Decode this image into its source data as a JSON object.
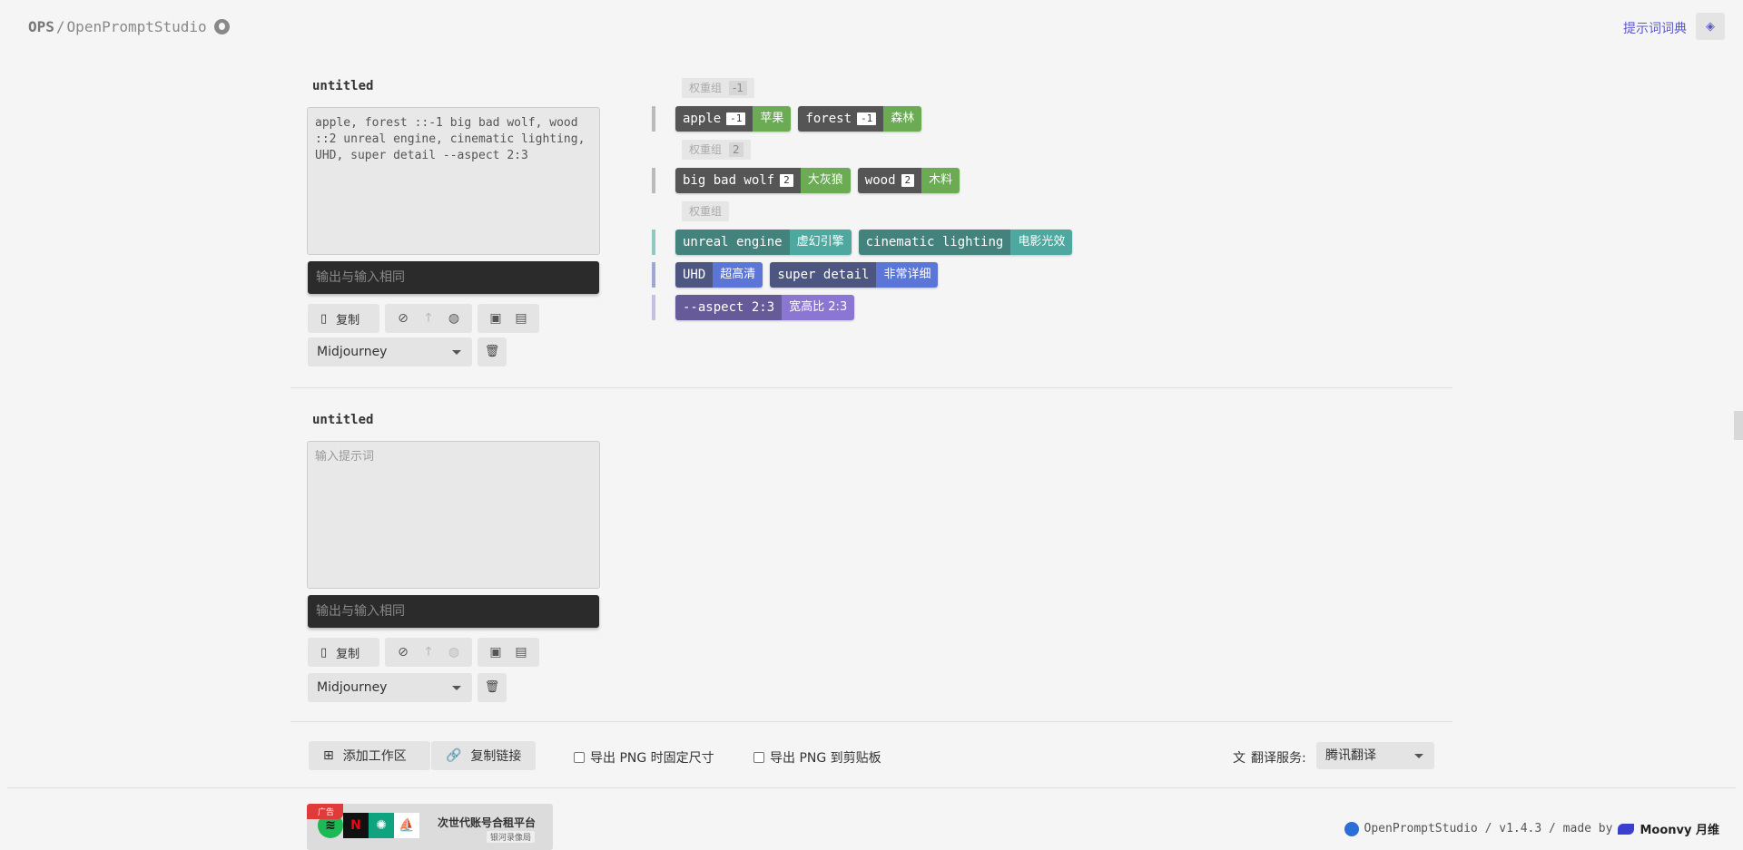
{
  "header": {
    "logo_ops": "OPS",
    "logo_sep": "/",
    "logo_name": "OpenPromptStudio",
    "dict_link": "提示词词典"
  },
  "workspaces": [
    {
      "title": "untitled",
      "prompt": "apple, forest ::-1 big bad wolf, wood ::2 unreal engine, cinematic lighting, UHD, super detail --aspect 2:3",
      "output": "输出与输入相同",
      "copy_label": "复制",
      "model": "Midjourney",
      "groups": [
        {
          "label": "权重组",
          "weight": "-1",
          "rows": [
            [
              {
                "en": "apple",
                "w": "-1",
                "cn": "苹果",
                "c1": "#555555",
                "c2": "#6aab54"
              },
              {
                "en": "forest",
                "w": "-1",
                "cn": "森林",
                "c1": "#555555",
                "c2": "#6aab54"
              }
            ]
          ]
        },
        {
          "label": "权重组",
          "weight": "2",
          "rows": [
            [
              {
                "en": "big bad wolf",
                "w": "2",
                "cn": "大灰狼",
                "c1": "#555555",
                "c2": "#6aab54"
              },
              {
                "en": "wood",
                "w": "2",
                "cn": "木料",
                "c1": "#555555",
                "c2": "#6aab54"
              }
            ]
          ]
        },
        {
          "label": "权重组",
          "weight": "",
          "rows": [
            [
              {
                "en": "unreal engine",
                "w": "",
                "cn": "虚幻引擎",
                "c1": "#44827e",
                "c2": "#4ea89f"
              },
              {
                "en": "cinematic lighting",
                "w": "",
                "cn": "电影光效",
                "c1": "#44827e",
                "c2": "#4ea89f"
              }
            ],
            [
              {
                "en": "UHD",
                "w": "",
                "cn": "超高清",
                "c1": "#4c5680",
                "c2": "#5b76d6"
              },
              {
                "en": "super detail",
                "w": "",
                "cn": "非常详细",
                "c1": "#4c5680",
                "c2": "#5b76d6"
              }
            ],
            [
              {
                "en": "--aspect 2:3",
                "w": "",
                "cn": "宽高比 2:3",
                "c1": "#665a99",
                "c2": "#8b76d3"
              }
            ]
          ]
        }
      ]
    },
    {
      "title": "untitled",
      "prompt_placeholder": "输入提示词",
      "output": "输出与输入相同",
      "copy_label": "复制",
      "model": "Midjourney"
    }
  ],
  "bottom": {
    "add_workspace": "添加工作区",
    "copy_link": "复制链接",
    "export_fixed": "导出 PNG 时固定尺寸",
    "export_clipboard": "导出 PNG 到剪贴板",
    "translate_label": "翻译服务:",
    "translate_value": "腾讯翻译"
  },
  "ad": {
    "tag": "广告",
    "title": "次世代账号合租平台",
    "sub": "银河录像局"
  },
  "footer": {
    "text": "OpenPromptStudio / v1.4.3 / made by",
    "brand": "Moonvy 月维"
  },
  "colors": {
    "accent": "#5b57c9",
    "output_bg": "#2b2b2b"
  }
}
